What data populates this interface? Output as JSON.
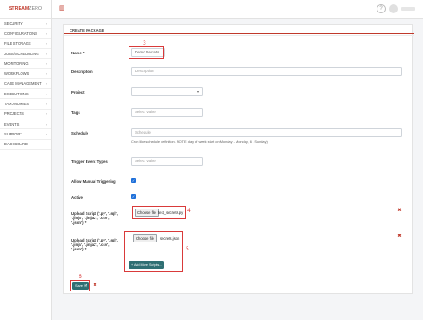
{
  "brand": {
    "part1": "STREAM",
    "part2": "ZERO"
  },
  "sidebar": {
    "items": [
      {
        "label": "SECURITY"
      },
      {
        "label": "CONFIGURATIONS"
      },
      {
        "label": "FILE STORAGE"
      },
      {
        "label": "JOBS/SCHEDULING"
      },
      {
        "label": "MONITORING"
      },
      {
        "label": "WORKFLOWS"
      },
      {
        "label": "CASE MANAGEMENT"
      },
      {
        "label": "EXECUTIONS"
      },
      {
        "label": "TAXONOMIES"
      },
      {
        "label": "PROJECTS"
      },
      {
        "label": "EVENTS"
      },
      {
        "label": "SUPPORT"
      },
      {
        "label": "DASHBOARD"
      }
    ]
  },
  "topbar": {
    "menu_icon": "sidebar-toggle-icon",
    "help_glyph": "?"
  },
  "form": {
    "title": "CREATE PACKAGE",
    "name": {
      "label": "Name *",
      "value": "Demo Secrets"
    },
    "description": {
      "label": "Description",
      "placeholder": "Description"
    },
    "project": {
      "label": "Project",
      "value": ""
    },
    "tags": {
      "label": "Tags",
      "placeholder": "Select Value"
    },
    "schedule": {
      "label": "Schedule",
      "placeholder": "Schedule",
      "hint": "Cron like schedule definition. NOTE: day of week start on Monday - Monday, 6 - Sunday)"
    },
    "trigger_event_types": {
      "label": "Trigger Event Types",
      "placeholder": "Select Value"
    },
    "allow_manual_triggering": {
      "label": "Allow Manual Triggering",
      "checked": true
    },
    "active": {
      "label": "Active",
      "checked": true
    },
    "upload_label_1": {
      "line1": "Upload Script ('.py', '.sql',",
      "line2": "'.jinja', '.jinja2', '.csv',",
      "line3": "'.json') *"
    },
    "upload_1": {
      "button": "Choose file",
      "file": "test_secrets.py"
    },
    "upload_label_2": {
      "line1": "Upload Script ('.py', '.sql',",
      "line2": "'.jinja', '.jinja2', '.csv',",
      "line3": "'.json') *"
    },
    "upload_2": {
      "button": "Choose file",
      "file": "secrets.json"
    },
    "add_more_label": "+ Add More Scripts...",
    "save_label": "Save 🗎",
    "delete_glyph": "✖"
  },
  "annotations": {
    "a3": "3",
    "a4": "4",
    "a5": "5",
    "a6": "6"
  },
  "colors": {
    "accent": "#c0392b",
    "button": "#2f6f73",
    "annotation": "#d93a3a",
    "checkbox": "#1e6fd9"
  }
}
